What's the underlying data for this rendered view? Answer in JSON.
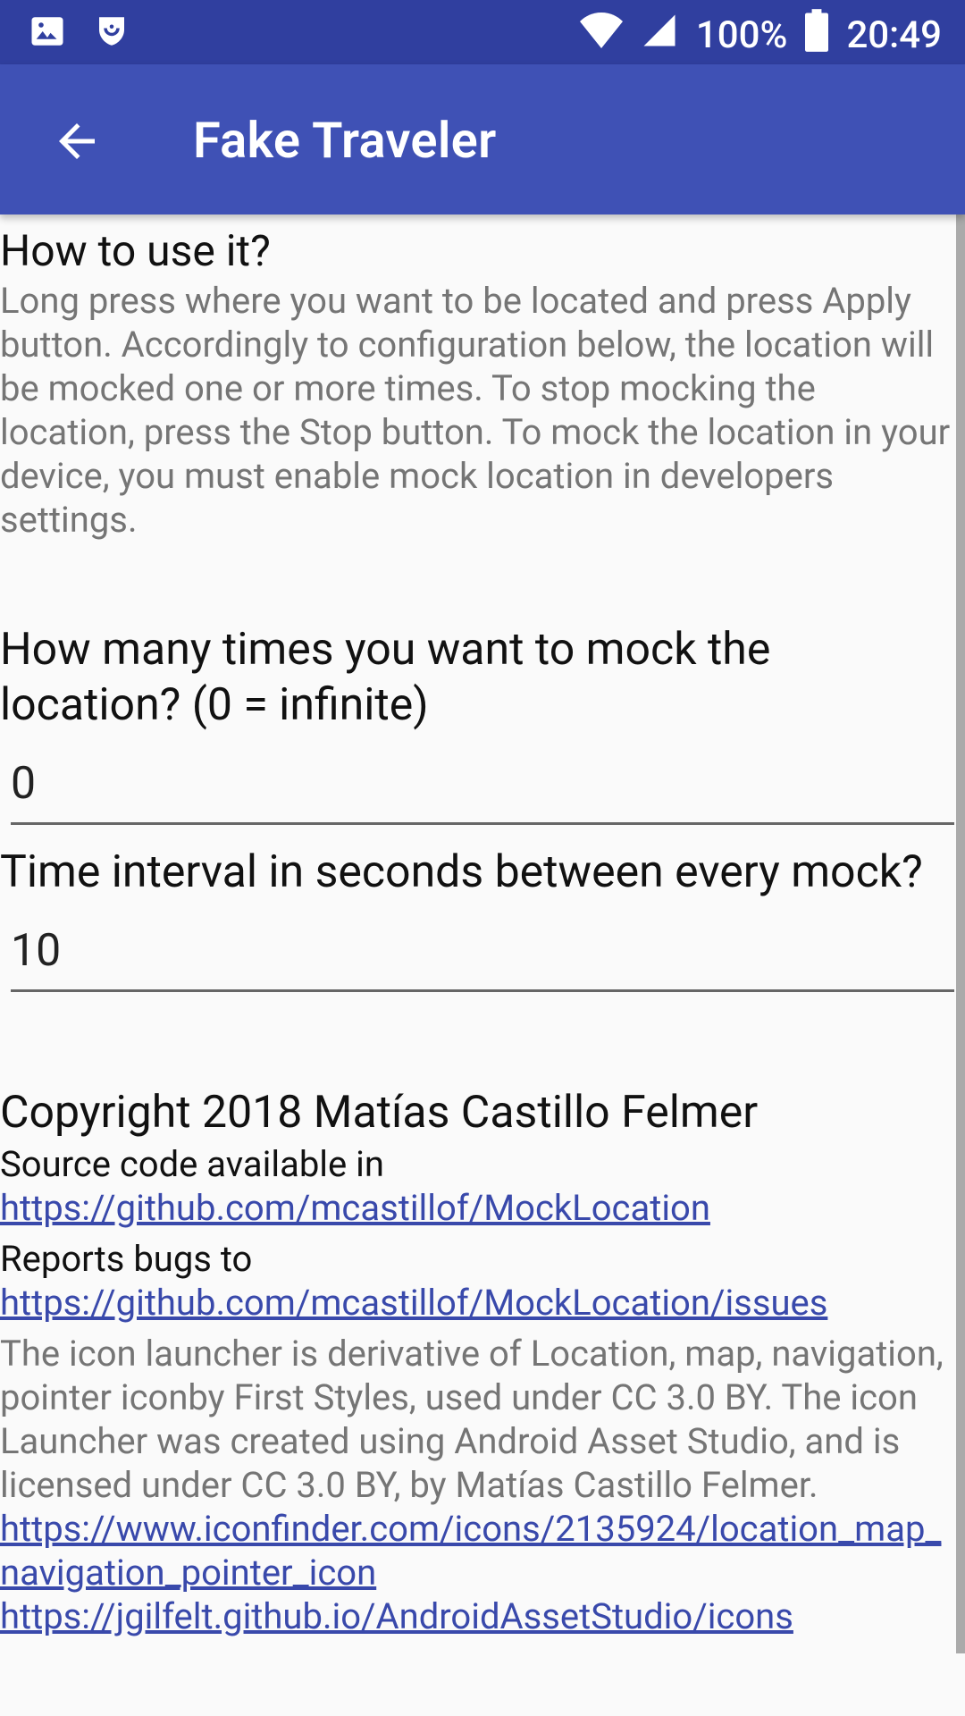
{
  "status_bar": {
    "battery": "100%",
    "time": "20:49",
    "icons": [
      "image-icon",
      "shield-icon",
      "wifi-icon",
      "signal-icon",
      "battery-icon"
    ]
  },
  "app_bar": {
    "title": "Fake Traveler",
    "back_icon": "arrow-back-icon"
  },
  "how_to": {
    "heading": "How to use it?",
    "text": "Long press where you want to be located and press Apply button. Accordingly to configuration below, the location will be mocked one or more times. To stop mocking the location, press the Stop button. To mock the location in your device, you must enable mock location in developers settings."
  },
  "mock_times": {
    "label": "How many times you want to mock the location? (0 = infinite)",
    "value": "0"
  },
  "interval": {
    "label": "Time interval in seconds between every mock?",
    "value": "10"
  },
  "footer": {
    "copyright": "Copyright 2018 Matías Castillo Felmer",
    "source_prefix": "Source code available in",
    "source_link": "https://github.com/mcastillof/MockLocation",
    "bugs_prefix": "Reports bugs to ",
    "bugs_link": "https://github.com/mcastillof/MockLocation/issues",
    "icon_text": "The icon launcher is derivative of Location, map, navigation, pointer iconby First Styles, used under CC 3.0 BY. The icon Launcher was created using Android Asset Studio, and is licensed under CC 3.0 BY, by Matías Castillo Felmer.",
    "icon_link": "https://www.iconfinder.com/icons/2135924/location_map_navigation_pointer_icon",
    "studio_link": "https://jgilfelt.github.io/AndroidAssetStudio/icons"
  },
  "colors": {
    "status_bar": "#303f9f",
    "app_bar": "#3f51b5",
    "link": "#3949ab"
  }
}
